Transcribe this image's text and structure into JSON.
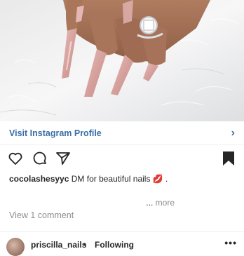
{
  "post": {
    "image_alt": "hand with pink coffin nails and diamond ring on white fur",
    "visit_profile_label": "Visit Instagram Profile",
    "visit_chevron": "›",
    "icons": {
      "like": "heart-icon",
      "comment": "comment-icon",
      "share": "paper-plane-icon",
      "save": "bookmark-icon"
    },
    "caption": {
      "username": "cocolashesyyc",
      "text": "DM for beautiful nails 💋 ."
    },
    "more_ellipsis": "...",
    "more_label": "more",
    "comments_link": "View 1 comment"
  },
  "footer": {
    "username": "priscilla_nails",
    "separator": "•",
    "follow_status": "Following",
    "menu": "•••"
  },
  "colors": {
    "link_blue": "#3a6fa8",
    "muted": "#8e8e8e",
    "text": "#262626",
    "nail_pink": "#d9a9a6"
  }
}
